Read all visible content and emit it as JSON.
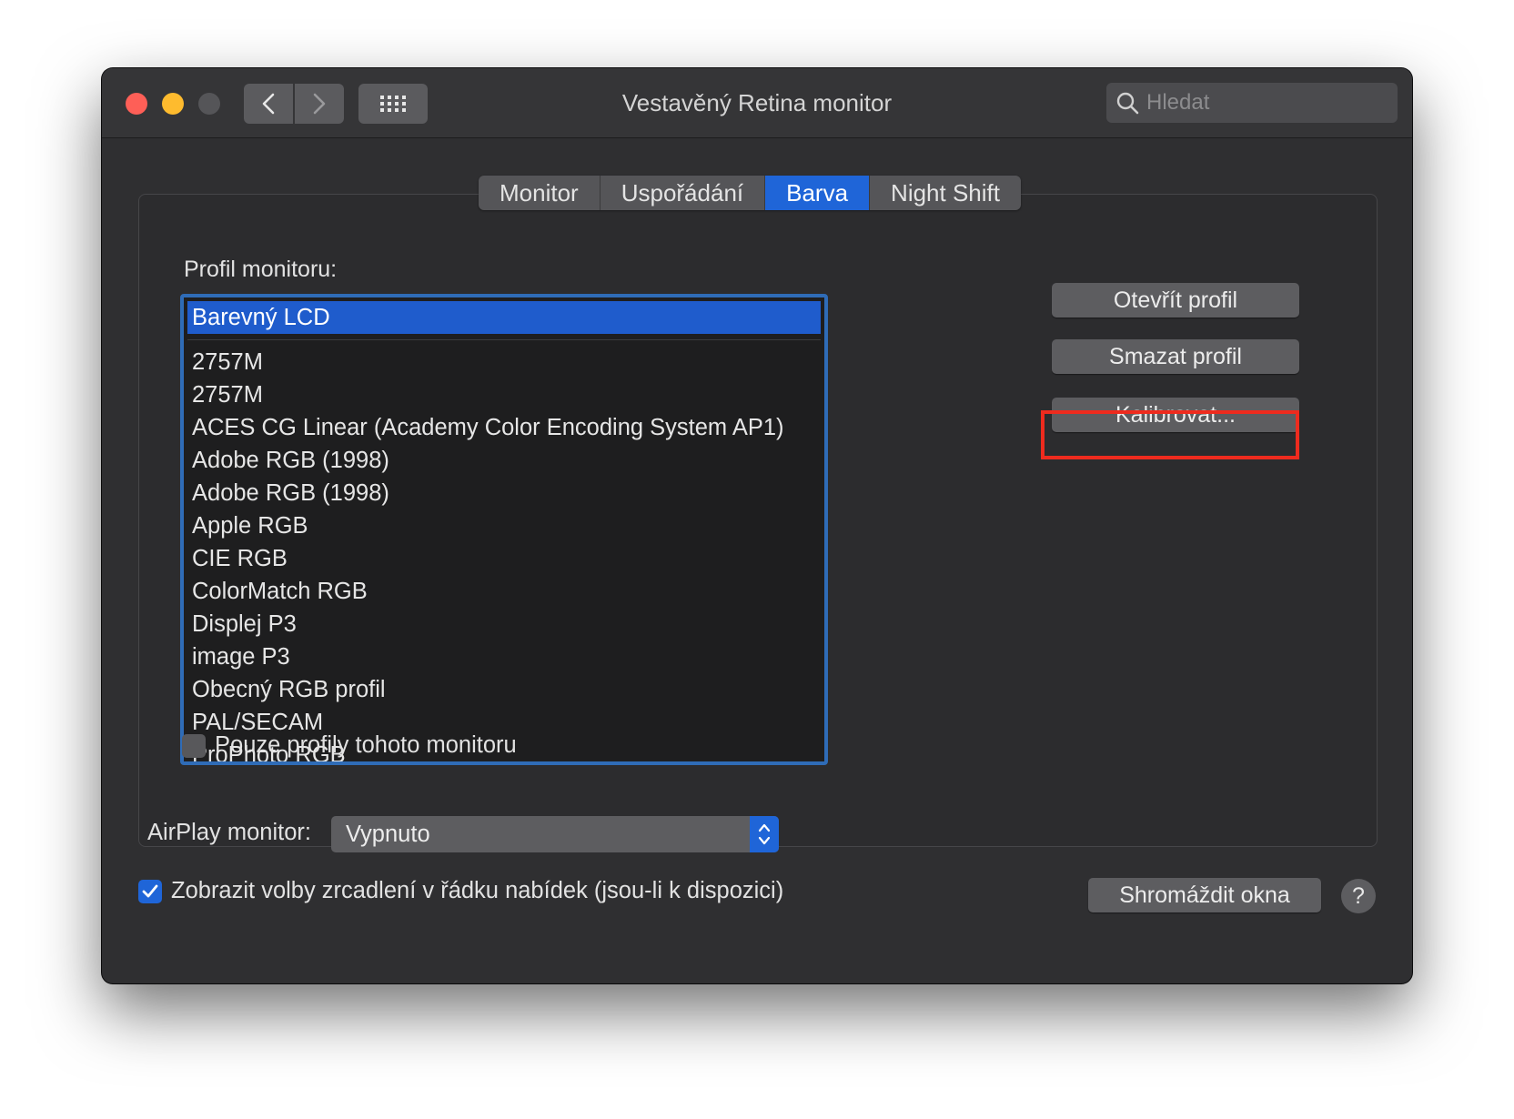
{
  "window": {
    "title": "Vestavěný Retina monitor",
    "search": {
      "placeholder": "Hledat"
    }
  },
  "tabs": [
    {
      "label": "Monitor",
      "active": false
    },
    {
      "label": "Uspořádání",
      "active": false
    },
    {
      "label": "Barva",
      "active": true
    },
    {
      "label": "Night Shift",
      "active": false
    }
  ],
  "color": {
    "profile_label": "Profil monitoru:",
    "profiles": {
      "selected": "Barevný LCD",
      "items": [
        "2757M",
        "2757M",
        "ACES CG Linear (Academy Color Encoding System AP1)",
        "Adobe RGB (1998)",
        "Adobe RGB (1998)",
        "Apple RGB",
        "CIE RGB",
        "ColorMatch RGB",
        "Displej P3",
        "image P3",
        "Obecný RGB profil",
        "PAL/SECAM",
        "ProPhoto RGB"
      ]
    },
    "only_this_monitor": {
      "label": "Pouze profily tohoto monitoru",
      "checked": false
    },
    "buttons": {
      "open_profile": "Otevřít profil",
      "delete_profile": "Smazat profil",
      "calibrate": "Kalibrovat..."
    }
  },
  "airplay": {
    "label": "AirPlay monitor:",
    "value": "Vypnuto"
  },
  "mirroring": {
    "label": "Zobrazit volby zrcadlení v řádku nabídek (jsou-li k dispozici)",
    "checked": true
  },
  "gather_windows": "Shromáždit okna",
  "help": "?",
  "colors": {
    "accent": "#1f65d8",
    "highlight": "#ee2b1e"
  }
}
